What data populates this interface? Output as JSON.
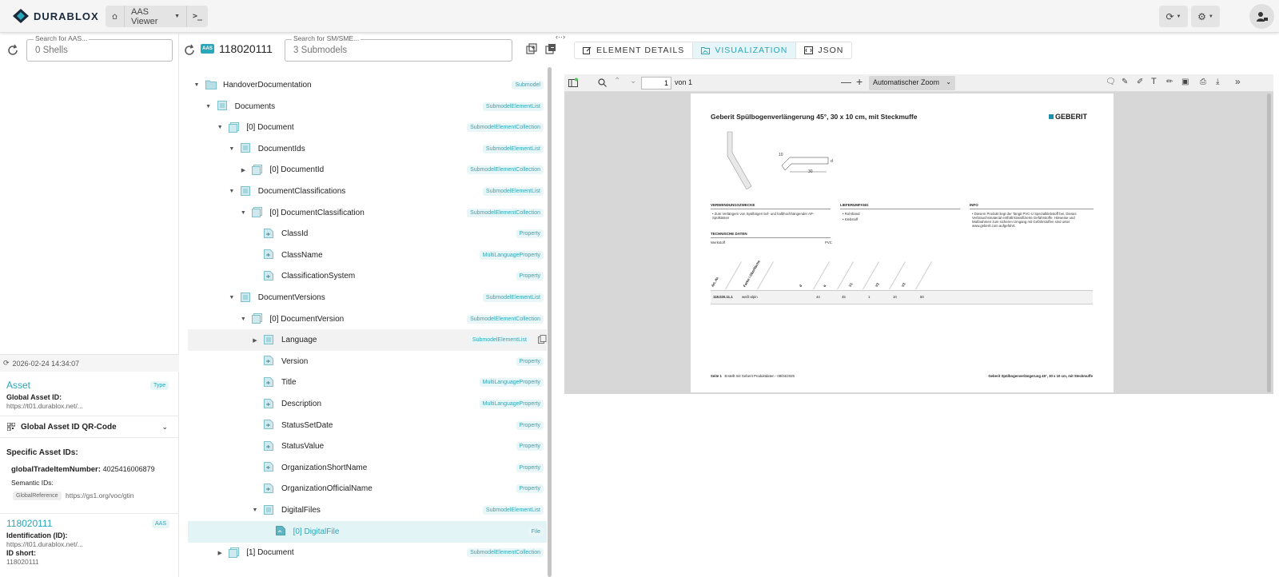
{
  "app": {
    "brand": "DURABLOX",
    "nav_view": "AAS Viewer"
  },
  "left": {
    "search_label": "Search for AAS...",
    "search_placeholder": "0 Shells",
    "timestamp": "2026-02-24 14:34:07",
    "asset_title": "Asset",
    "asset_badge": "Type",
    "global_asset_id_label": "Global Asset ID:",
    "global_asset_id_value": "https://t01.durablox.net/...",
    "qr_label": "Global Asset ID QR-Code",
    "specific_ids_label": "Specific Asset IDs:",
    "gtin_key": "globalTradeItemNumber:",
    "gtin_value": "4025416006879",
    "semantic_label": "Semantic IDs:",
    "semantic_chip": "GlobalReference",
    "semantic_value": "https://gs1.org/voc/gtin",
    "aas_title": "118020111",
    "aas_badge": "AAS",
    "ident_label": "Identification (ID):",
    "ident_value": "https://t01.durablox.net/...",
    "idshort_label": "ID short:",
    "idshort_value": "118020111"
  },
  "mid": {
    "aas_label": "AAS",
    "aas_id": "118020111",
    "search_label": "Search for SM/SME...",
    "search_placeholder": "3 Submodels",
    "tree": [
      {
        "name": "HandoverDocumentation",
        "badge": "Submodel"
      },
      {
        "name": "Documents",
        "badge": "SubmodelElementList"
      },
      {
        "name": "[0] Document",
        "badge": "SubmodelElementCollection"
      },
      {
        "name": "DocumentIds",
        "badge": "SubmodelElementList"
      },
      {
        "name": "[0] DocumentId",
        "badge": "SubmodelElementCollection"
      },
      {
        "name": "DocumentClassifications",
        "badge": "SubmodelElementList"
      },
      {
        "name": "[0] DocumentClassification",
        "badge": "SubmodelElementCollection"
      },
      {
        "name": "ClassId",
        "badge": "Property"
      },
      {
        "name": "ClassName",
        "badge": "MultiLanguageProperty"
      },
      {
        "name": "ClassificationSystem",
        "badge": "Property"
      },
      {
        "name": "DocumentVersions",
        "badge": "SubmodelElementList"
      },
      {
        "name": "[0] DocumentVersion",
        "badge": "SubmodelElementCollection"
      },
      {
        "name": "Language",
        "badge": "SubmodelElementList"
      },
      {
        "name": "Version",
        "badge": "Property"
      },
      {
        "name": "Title",
        "badge": "MultiLanguageProperty"
      },
      {
        "name": "Description",
        "badge": "MultiLanguageProperty"
      },
      {
        "name": "StatusSetDate",
        "badge": "Property"
      },
      {
        "name": "StatusValue",
        "badge": "Property"
      },
      {
        "name": "OrganizationShortName",
        "badge": "Property"
      },
      {
        "name": "OrganizationOfficialName",
        "badge": "Property"
      },
      {
        "name": "DigitalFiles",
        "badge": "SubmodelElementList"
      },
      {
        "name": "[0] DigitalFile",
        "badge": "File"
      },
      {
        "name": "[1] Document",
        "badge": "SubmodelElementCollection"
      }
    ]
  },
  "right": {
    "tabs": {
      "details": "ELEMENT DETAILS",
      "visualization": "VISUALIZATION",
      "json": "JSON"
    },
    "pdf": {
      "page": "1",
      "of": "von 1",
      "zoom": "Automatischer Zoom",
      "title": "Geberit Spülbogenverlängerung 45°, 30 x 10 cm, mit Steckmuffe",
      "brand": "GEBERIT",
      "dim_10": "10",
      "dim_30": "30",
      "dim_d": "d",
      "sec_use": "VERWENDUNGSZWECKE",
      "use_text": "Zum Verlängern von Spülbögen tief- und halbhochhängender AP-Spülkästen",
      "sec_scope": "LIEFERUMFANG",
      "scope_1": "Rohrband",
      "scope_2": "Klebstoff",
      "sec_info": "INFO",
      "info_text": "Diesem Produkt liegt der Tangit PVC-U Spezialklebstoff bei. Dieses Verbrauchsmaterial enthält klassifizierte Gefahrstoffe. Hinweise und Maßnahmen zum sicheren Umgang mit Gefahrstoffen sind unter www.geberit.com aufgeführt.",
      "sec_tech": "TECHNISCHE DATEN",
      "tech_key": "Werkstoff",
      "tech_val": "PVC",
      "col_headers": [
        "Art.-Nr.",
        "Farbe / Oberfläche",
        "d",
        "α",
        "V1",
        "V2",
        "V3"
      ],
      "row": [
        "118.020.11.1",
        "weiß-alpin",
        "44",
        "45",
        "1",
        "10",
        "50"
      ],
      "footer_left": "Seite 1",
      "footer_mid": "Erstellt mit Geberit Produktdaten - 08/04/2025",
      "footer_right": "Geberit Spülbogenverlängerung 45°, 30 x 10 cm, mit Steckmuffe"
    }
  }
}
